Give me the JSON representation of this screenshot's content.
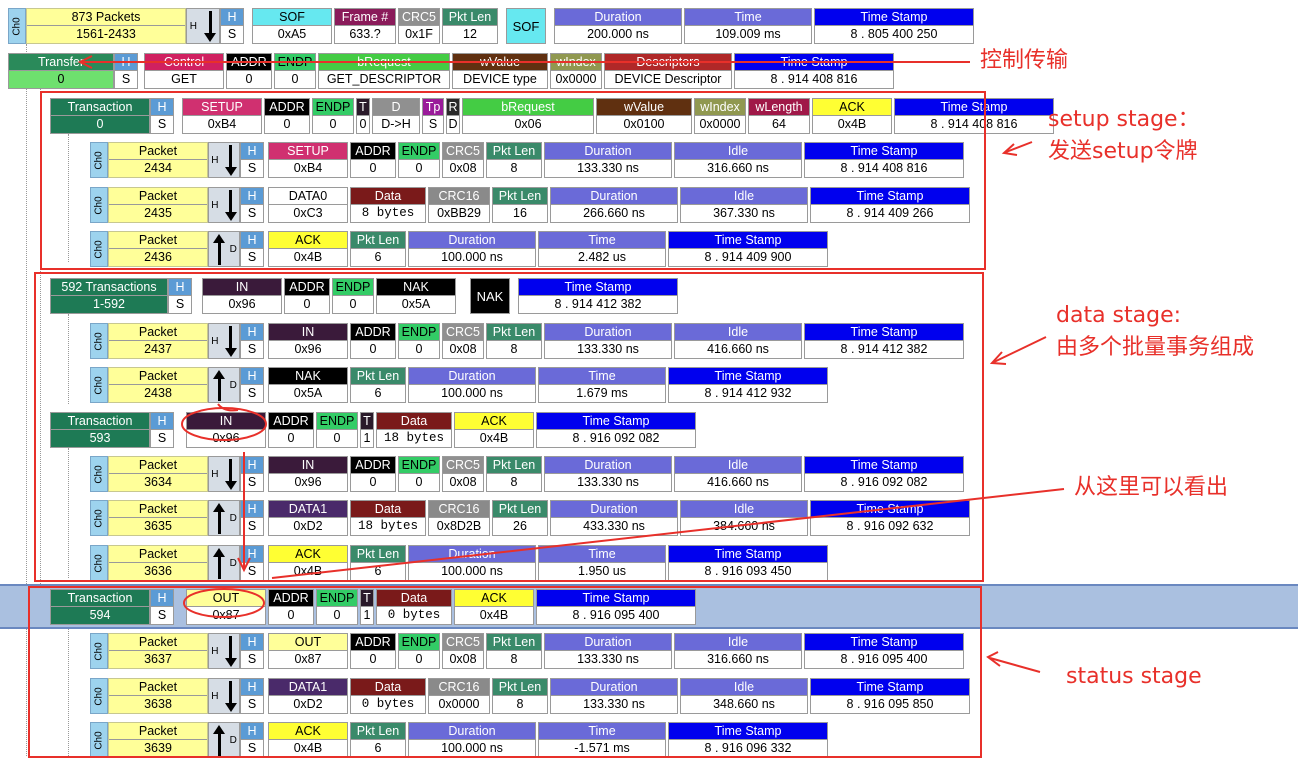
{
  "colors": {
    "accent_red": "#e8302a",
    "packet_yellow": "#ffff99",
    "hl_blue": "#aac0e0"
  },
  "annotations": {
    "control_transfer": "控制传输",
    "setup_stage": "setup stage：",
    "setup_desc": "发送setup令牌",
    "data_stage": "data stage:",
    "data_desc": "由多个批量事务组成",
    "see_here": "从这里可以看出",
    "status_stage": "status stage"
  },
  "channel": "Ch0",
  "rows": {
    "sof": {
      "packets_h": "873 Packets",
      "packets_v": "1561-2433",
      "h": "H",
      "s": "S",
      "cells": [
        {
          "h": "SOF",
          "v": "0xA5"
        },
        {
          "h": "Frame #",
          "v": "633.?"
        },
        {
          "h": "CRC5",
          "v": "0x1F"
        },
        {
          "h": "Pkt Len",
          "v": "12"
        }
      ],
      "sof_tag": "SOF",
      "tail": [
        {
          "h": "Duration",
          "v": "200.000 ns"
        },
        {
          "h": "Time",
          "v": "109.009 ms"
        },
        {
          "h": "Time Stamp",
          "v": "8 . 805 400 250"
        }
      ]
    },
    "transfer": {
      "name_h": "Transfer",
      "name_v": "0",
      "h": "H",
      "s": "S",
      "cells": [
        {
          "h": "Control",
          "v": "GET"
        },
        {
          "h": "ADDR",
          "v": "0"
        },
        {
          "h": "ENDP",
          "v": "0"
        },
        {
          "h": "bRequest",
          "v": "GET_DESCRIPTOR"
        },
        {
          "h": "wValue",
          "v": "DEVICE type"
        },
        {
          "h": "wIndex",
          "v": "0x0000"
        },
        {
          "h": "Descriptors",
          "v": "DEVICE Descriptor"
        },
        {
          "h": "Time Stamp",
          "v": "8 . 914 408 816"
        }
      ]
    },
    "trans0": {
      "name_h": "Transaction",
      "name_v": "0",
      "h": "H",
      "s": "S",
      "cells": [
        {
          "h": "SETUP",
          "v": "0xB4"
        },
        {
          "h": "ADDR",
          "v": "0"
        },
        {
          "h": "ENDP",
          "v": "0"
        },
        {
          "h": "T",
          "v": "0"
        },
        {
          "h": "D",
          "v": "D->H"
        },
        {
          "h": "Tp",
          "v": "S"
        },
        {
          "h": "R",
          "v": "D"
        },
        {
          "h": "bRequest",
          "v": "0x06"
        },
        {
          "h": "wValue",
          "v": "0x0100"
        },
        {
          "h": "wIndex",
          "v": "0x0000"
        },
        {
          "h": "wLength",
          "v": "64"
        },
        {
          "h": "ACK",
          "v": "0x4B"
        },
        {
          "h": "Time Stamp",
          "v": "8 . 914 408 816"
        }
      ]
    },
    "p2434": {
      "name_h": "Packet",
      "name_v": "2434",
      "h": "H",
      "s": "S",
      "cells": [
        {
          "h": "SETUP",
          "v": "0xB4"
        },
        {
          "h": "ADDR",
          "v": "0"
        },
        {
          "h": "ENDP",
          "v": "0"
        },
        {
          "h": "CRC5",
          "v": "0x08"
        },
        {
          "h": "Pkt Len",
          "v": "8"
        },
        {
          "h": "Duration",
          "v": "133.330 ns"
        },
        {
          "h": "Idle",
          "v": "316.660 ns"
        },
        {
          "h": "Time Stamp",
          "v": "8 . 914 408 816"
        }
      ]
    },
    "p2435": {
      "name_h": "Packet",
      "name_v": "2435",
      "h": "H",
      "s": "S",
      "cells": [
        {
          "h": "DATA0",
          "v": "0xC3"
        },
        {
          "h": "Data",
          "v": "8 bytes"
        },
        {
          "h": "CRC16",
          "v": "0xBB29"
        },
        {
          "h": "Pkt Len",
          "v": "16"
        },
        {
          "h": "Duration",
          "v": "266.660 ns"
        },
        {
          "h": "Idle",
          "v": "367.330 ns"
        },
        {
          "h": "Time Stamp",
          "v": "8 . 914 409 266"
        }
      ]
    },
    "p2436": {
      "name_h": "Packet",
      "name_v": "2436",
      "h": "H",
      "s": "S",
      "d": "D",
      "cells": [
        {
          "h": "ACK",
          "v": "0x4B"
        },
        {
          "h": "Pkt Len",
          "v": "6"
        },
        {
          "h": "Duration",
          "v": "100.000 ns"
        },
        {
          "h": "Time",
          "v": "2.482 us"
        },
        {
          "h": "Time Stamp",
          "v": "8 . 914 409 900"
        }
      ]
    },
    "trans592": {
      "name_h": "592 Transactions",
      "name_v": "1-592",
      "h": "H",
      "s": "S",
      "cells": [
        {
          "h": "IN",
          "v": "0x96"
        },
        {
          "h": "ADDR",
          "v": "0"
        },
        {
          "h": "ENDP",
          "v": "0"
        },
        {
          "h": "NAK",
          "v": "0x5A"
        }
      ],
      "nak_tag": "NAK",
      "tail": [
        {
          "h": "Time Stamp",
          "v": "8 . 914 412 382"
        }
      ]
    },
    "p2437": {
      "name_h": "Packet",
      "name_v": "2437",
      "h": "H",
      "s": "S",
      "cells": [
        {
          "h": "IN",
          "v": "0x96"
        },
        {
          "h": "ADDR",
          "v": "0"
        },
        {
          "h": "ENDP",
          "v": "0"
        },
        {
          "h": "CRC5",
          "v": "0x08"
        },
        {
          "h": "Pkt Len",
          "v": "8"
        },
        {
          "h": "Duration",
          "v": "133.330 ns"
        },
        {
          "h": "Idle",
          "v": "416.660 ns"
        },
        {
          "h": "Time Stamp",
          "v": "8 . 914 412 382"
        }
      ]
    },
    "p2438": {
      "name_h": "Packet",
      "name_v": "2438",
      "h": "H",
      "s": "S",
      "d": "D",
      "cells": [
        {
          "h": "NAK",
          "v": "0x5A"
        },
        {
          "h": "Pkt Len",
          "v": "6"
        },
        {
          "h": "Duration",
          "v": "100.000 ns"
        },
        {
          "h": "Time",
          "v": "1.679 ms"
        },
        {
          "h": "Time Stamp",
          "v": "8 . 914 412 932"
        }
      ]
    },
    "trans593": {
      "name_h": "Transaction",
      "name_v": "593",
      "h": "H",
      "s": "S",
      "cells": [
        {
          "h": "IN",
          "v": "0x96"
        },
        {
          "h": "ADDR",
          "v": "0"
        },
        {
          "h": "ENDP",
          "v": "0"
        },
        {
          "h": "T",
          "v": "1"
        },
        {
          "h": "Data",
          "v": "18 bytes"
        },
        {
          "h": "ACK",
          "v": "0x4B"
        },
        {
          "h": "Time Stamp",
          "v": "8 . 916 092 082"
        }
      ]
    },
    "p3634": {
      "name_h": "Packet",
      "name_v": "3634",
      "h": "H",
      "s": "S",
      "cells": [
        {
          "h": "IN",
          "v": "0x96"
        },
        {
          "h": "ADDR",
          "v": "0"
        },
        {
          "h": "ENDP",
          "v": "0"
        },
        {
          "h": "CRC5",
          "v": "0x08"
        },
        {
          "h": "Pkt Len",
          "v": "8"
        },
        {
          "h": "Duration",
          "v": "133.330 ns"
        },
        {
          "h": "Idle",
          "v": "416.660 ns"
        },
        {
          "h": "Time Stamp",
          "v": "8 . 916 092 082"
        }
      ]
    },
    "p3635": {
      "name_h": "Packet",
      "name_v": "3635",
      "h": "H",
      "s": "S",
      "d": "D",
      "cells": [
        {
          "h": "DATA1",
          "v": "0xD2"
        },
        {
          "h": "Data",
          "v": "18 bytes"
        },
        {
          "h": "CRC16",
          "v": "0x8D2B"
        },
        {
          "h": "Pkt Len",
          "v": "26"
        },
        {
          "h": "Duration",
          "v": "433.330 ns"
        },
        {
          "h": "Idle",
          "v": "384.660 ns"
        },
        {
          "h": "Time Stamp",
          "v": "8 . 916 092 632"
        }
      ]
    },
    "p3636": {
      "name_h": "Packet",
      "name_v": "3636",
      "h": "H",
      "s": "S",
      "d": "D",
      "cells": [
        {
          "h": "ACK",
          "v": "0x4B"
        },
        {
          "h": "Pkt Len",
          "v": "6"
        },
        {
          "h": "Duration",
          "v": "100.000 ns"
        },
        {
          "h": "Time",
          "v": "1.950 us"
        },
        {
          "h": "Time Stamp",
          "v": "8 . 916 093 450"
        }
      ]
    },
    "trans594": {
      "name_h": "Transaction",
      "name_v": "594",
      "h": "H",
      "s": "S",
      "cells": [
        {
          "h": "OUT",
          "v": "0x87"
        },
        {
          "h": "ADDR",
          "v": "0"
        },
        {
          "h": "ENDP",
          "v": "0"
        },
        {
          "h": "T",
          "v": "1"
        },
        {
          "h": "Data",
          "v": "0 bytes"
        },
        {
          "h": "ACK",
          "v": "0x4B"
        },
        {
          "h": "Time Stamp",
          "v": "8 . 916 095 400"
        }
      ]
    },
    "p3637": {
      "name_h": "Packet",
      "name_v": "3637",
      "h": "H",
      "s": "S",
      "cells": [
        {
          "h": "OUT",
          "v": "0x87"
        },
        {
          "h": "ADDR",
          "v": "0"
        },
        {
          "h": "ENDP",
          "v": "0"
        },
        {
          "h": "CRC5",
          "v": "0x08"
        },
        {
          "h": "Pkt Len",
          "v": "8"
        },
        {
          "h": "Duration",
          "v": "133.330 ns"
        },
        {
          "h": "Idle",
          "v": "316.660 ns"
        },
        {
          "h": "Time Stamp",
          "v": "8 . 916 095 400"
        }
      ]
    },
    "p3638": {
      "name_h": "Packet",
      "name_v": "3638",
      "h": "H",
      "s": "S",
      "cells": [
        {
          "h": "DATA1",
          "v": "0xD2"
        },
        {
          "h": "Data",
          "v": "0 bytes"
        },
        {
          "h": "CRC16",
          "v": "0x0000"
        },
        {
          "h": "Pkt Len",
          "v": "8"
        },
        {
          "h": "Duration",
          "v": "133.330 ns"
        },
        {
          "h": "Idle",
          "v": "348.660 ns"
        },
        {
          "h": "Time Stamp",
          "v": "8 . 916 095 850"
        }
      ]
    },
    "p3639": {
      "name_h": "Packet",
      "name_v": "3639",
      "h": "H",
      "s": "S",
      "d": "D",
      "cells": [
        {
          "h": "ACK",
          "v": "0x4B"
        },
        {
          "h": "Pkt Len",
          "v": "6"
        },
        {
          "h": "Duration",
          "v": "100.000 ns"
        },
        {
          "h": "Time",
          "v": "-1.571 ms"
        },
        {
          "h": "Time Stamp",
          "v": "8 . 916 096 332"
        }
      ]
    }
  }
}
